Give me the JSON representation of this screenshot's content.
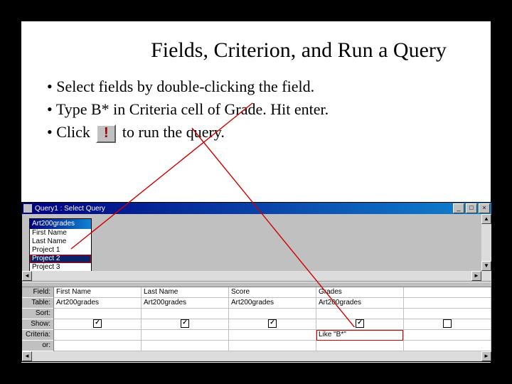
{
  "title": "Fields, Criterion, and Run a Query",
  "bullets": {
    "b1": "Select fields by double-clicking the field.",
    "b2a": "Type B*  in Criteria cell of Grade.  Hit enter.",
    "b3a": "Click ",
    "b3b": " to run the query.",
    "run_icon": "!"
  },
  "window": {
    "title": "Query1 : Select Query",
    "fieldlist": {
      "title": "Art200grades",
      "items": [
        "First Name",
        "Last Name",
        "Project 1",
        "Project 2",
        "Project 3"
      ],
      "selected_index": 3
    },
    "grid": {
      "rowlabels": [
        "Field:",
        "Table:",
        "Sort:",
        "Show:",
        "Criteria:",
        "or:"
      ],
      "columns": [
        {
          "field": "First Name",
          "table": "Art200grades",
          "show": true,
          "criteria": ""
        },
        {
          "field": "Last Name",
          "table": "Art200grades",
          "show": true,
          "criteria": ""
        },
        {
          "field": "Score",
          "table": "Art200grades",
          "show": true,
          "criteria": ""
        },
        {
          "field": "Grades",
          "table": "Art200grades",
          "show": true,
          "criteria": "Like \"B*\""
        }
      ]
    }
  }
}
